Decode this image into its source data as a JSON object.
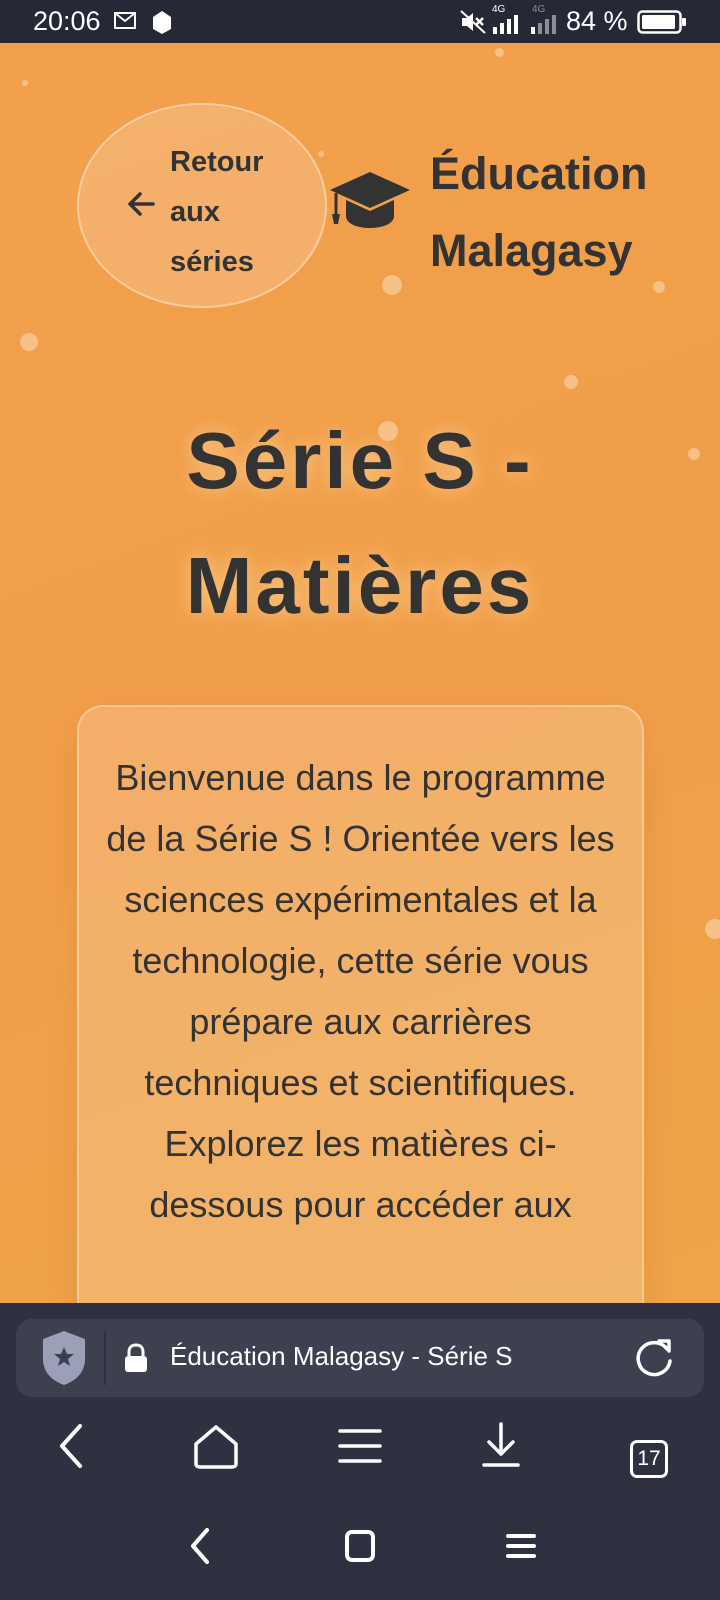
{
  "status_bar": {
    "time": "20:06",
    "network_label": "4G",
    "battery": "84 %",
    "icons": [
      "mail-icon",
      "app-notification-icon",
      "mute-icon",
      "signal-icon",
      "signal-icon-2",
      "battery-icon"
    ]
  },
  "header": {
    "back_label": "Retour aux séries",
    "brand_name": "Éducation Malagasy",
    "brand_icon": "graduation-cap-icon"
  },
  "main": {
    "title": "Série S - Matières",
    "intro": "Bienvenue dans le programme de la Série S ! Orientée vers les sciences expérimentales et la technologie, cette série vous prépare aux carrières techniques et scientifiques. Explorez les matières ci-dessous pour accéder aux"
  },
  "browser": {
    "url_title": "Éducation Malagasy - Série S",
    "tab_count": "17",
    "toolbar_icons": [
      "back-icon",
      "home-icon",
      "menu-icon",
      "download-icon",
      "tabs-icon"
    ]
  },
  "colors": {
    "page_bg": "#f2a04c",
    "text": "#333333",
    "browser_bg": "#2f3140",
    "status_bg": "#262835"
  }
}
